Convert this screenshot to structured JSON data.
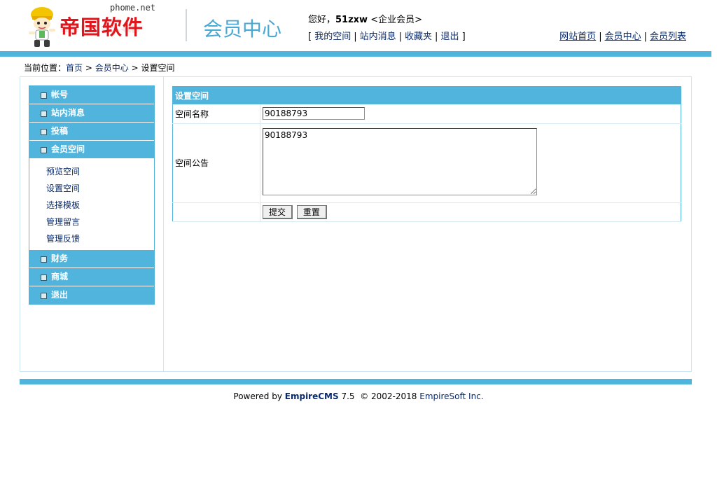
{
  "header": {
    "logo": {
      "brand": "帝国软件",
      "domain": "phome.net"
    },
    "center_title": "会员中心",
    "greeting": {
      "prefix": "您好，",
      "username": "51zxw",
      "group": "<企业会员>"
    },
    "top_links": [
      {
        "label": "我的空间"
      },
      {
        "label": "站内消息"
      },
      {
        "label": "收藏夹"
      },
      {
        "label": "退出"
      }
    ],
    "right_links": [
      {
        "label": "网站首页"
      },
      {
        "label": "会员中心"
      },
      {
        "label": "会员列表"
      }
    ]
  },
  "breadcrumb": {
    "prefix": "当前位置：",
    "items": [
      "首页",
      "会员中心",
      "设置空间"
    ],
    "separator": ">"
  },
  "sidebar": {
    "sections": [
      {
        "label": "帐号"
      },
      {
        "label": "站内消息"
      },
      {
        "label": "投稿"
      },
      {
        "label": "会员空间",
        "expanded": true,
        "items": [
          "预览空间",
          "设置空间",
          "选择模板",
          "管理留言",
          "管理反馈"
        ]
      },
      {
        "label": "财务"
      },
      {
        "label": "商城"
      },
      {
        "label": "退出"
      }
    ]
  },
  "form": {
    "title": "设置空间",
    "space_name_label": "空间名称",
    "space_name_value": "90188793",
    "notice_label": "空间公告",
    "notice_value": "90188793",
    "submit_label": "提交",
    "reset_label": "重置"
  },
  "footer": {
    "powered_by": "Powered by",
    "product": "EmpireCMS",
    "version": "7.5",
    "copyright": "© 2002-2018",
    "company": "EmpireSoft Inc."
  },
  "colors": {
    "accent": "#51b4dd",
    "brand_red": "#e0161d",
    "link": "#0a2a6b"
  }
}
